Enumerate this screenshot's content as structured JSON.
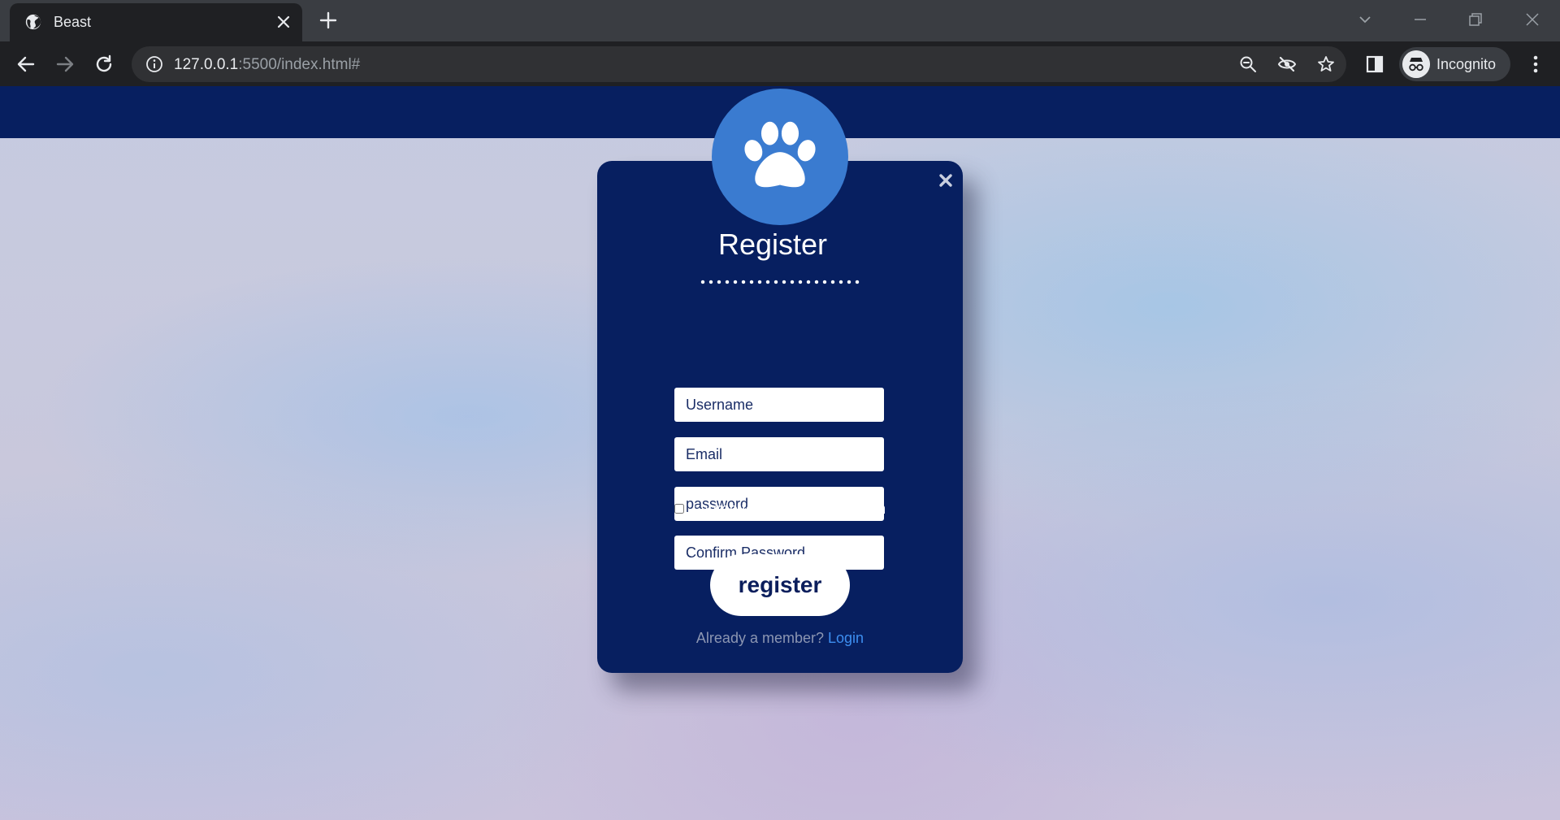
{
  "browser": {
    "tab": {
      "title": "Beast"
    },
    "address": {
      "host": "127.0.0.1",
      "rest": ":5500/index.html#"
    },
    "profile": {
      "label": "Incognito"
    }
  },
  "modal": {
    "title": "Register",
    "fields": {
      "username_placeholder": "Username",
      "email_placeholder": "Email",
      "password_placeholder": "password",
      "confirm_placeholder": "Confirm Password"
    },
    "terms_label": "I agree to terms and condition",
    "register_label": "register",
    "member_text": "Already a member?",
    "login_label": "Login"
  },
  "colors": {
    "navbar": "#071f60",
    "card": "#071f60",
    "avatar": "#3a7bd0",
    "link": "#3d8ef0"
  }
}
